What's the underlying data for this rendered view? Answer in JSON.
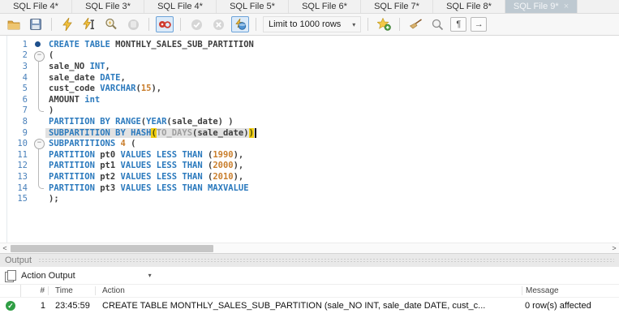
{
  "glyphs": {
    "close": "×",
    "dropdown": "▾",
    "scroll_left": "<",
    "scroll_right": ">",
    "pilcrow": "¶",
    "wrap_arrow": "→",
    "check": "✓"
  },
  "tabs": [
    {
      "label": "SQL File 4*",
      "active": false
    },
    {
      "label": "SQL File 3*",
      "active": false
    },
    {
      "label": "SQL File 4*",
      "active": false
    },
    {
      "label": "SQL File 5*",
      "active": false
    },
    {
      "label": "SQL File 6*",
      "active": false
    },
    {
      "label": "SQL File 7*",
      "active": false
    },
    {
      "label": "SQL File 8*",
      "active": false
    },
    {
      "label": "SQL File 9*",
      "active": true
    }
  ],
  "toolbar": {
    "limit_label": "Limit to 1000 rows",
    "icons": [
      "open-file",
      "save",
      "execute",
      "execute-current-statement",
      "explain",
      "stop",
      "toggle-stop-on-error",
      "commit",
      "rollback",
      "toggle-autocommit",
      "save-snippet",
      "beautify",
      "find",
      "show-invisible-characters",
      "toggle-wrap"
    ]
  },
  "editor": {
    "lines": [
      {
        "n": "1",
        "marker": "dot",
        "segments": [
          {
            "t": "CREATE TABLE",
            "c": "kw"
          },
          {
            "t": " MONTHLY_SALES_SUB_PARTITION",
            "c": "id"
          }
        ]
      },
      {
        "n": "2",
        "marker": "open",
        "segments": [
          {
            "t": "(",
            "c": "id"
          }
        ]
      },
      {
        "n": "3",
        "marker": "vline",
        "segments": [
          {
            "t": "sale_NO ",
            "c": "id"
          },
          {
            "t": "INT",
            "c": "kw"
          },
          {
            "t": ",",
            "c": "id"
          }
        ]
      },
      {
        "n": "4",
        "marker": "vline",
        "segments": [
          {
            "t": "sale_date ",
            "c": "id"
          },
          {
            "t": "DATE",
            "c": "kw"
          },
          {
            "t": ",",
            "c": "id"
          }
        ]
      },
      {
        "n": "5",
        "marker": "vline",
        "segments": [
          {
            "t": "cust_code ",
            "c": "id"
          },
          {
            "t": "VARCHAR",
            "c": "kw"
          },
          {
            "t": "(",
            "c": "id"
          },
          {
            "t": "15",
            "c": "num"
          },
          {
            "t": "),",
            "c": "id"
          }
        ]
      },
      {
        "n": "6",
        "marker": "vline",
        "segments": [
          {
            "t": "AMOUNT ",
            "c": "id"
          },
          {
            "t": "int",
            "c": "kw"
          }
        ]
      },
      {
        "n": "7",
        "marker": "end",
        "segments": [
          {
            "t": ")",
            "c": "id"
          }
        ]
      },
      {
        "n": "8",
        "marker": "",
        "segments": [
          {
            "t": "PARTITION BY RANGE",
            "c": "kw"
          },
          {
            "t": "(",
            "c": "id"
          },
          {
            "t": "YEAR",
            "c": "kw"
          },
          {
            "t": "(sale_date) )",
            "c": "id"
          }
        ]
      },
      {
        "n": "9",
        "marker": "",
        "highlight": true,
        "cursor": true,
        "segments": [
          {
            "t": "SUBPARTITION BY HASH",
            "c": "kw"
          },
          {
            "t": "(",
            "c": "hlp"
          },
          {
            "t": "TO_DAYS",
            "c": "fn"
          },
          {
            "t": "(sale_date)",
            "c": "id"
          },
          {
            "t": ")",
            "c": "hlp"
          }
        ]
      },
      {
        "n": "10",
        "marker": "open",
        "segments": [
          {
            "t": "SUBPARTITIONS ",
            "c": "kw"
          },
          {
            "t": "4",
            "c": "num"
          },
          {
            "t": " (",
            "c": "id"
          }
        ]
      },
      {
        "n": "11",
        "marker": "vline",
        "segments": [
          {
            "t": "PARTITION ",
            "c": "kw"
          },
          {
            "t": "pt0 ",
            "c": "id"
          },
          {
            "t": "VALUES LESS THAN ",
            "c": "kw"
          },
          {
            "t": "(",
            "c": "id"
          },
          {
            "t": "1990",
            "c": "num"
          },
          {
            "t": "),",
            "c": "id"
          }
        ]
      },
      {
        "n": "12",
        "marker": "vline",
        "segments": [
          {
            "t": "PARTITION ",
            "c": "kw"
          },
          {
            "t": "pt1 ",
            "c": "id"
          },
          {
            "t": "VALUES LESS THAN ",
            "c": "kw"
          },
          {
            "t": "(",
            "c": "id"
          },
          {
            "t": "2000",
            "c": "num"
          },
          {
            "t": "),",
            "c": "id"
          }
        ]
      },
      {
        "n": "13",
        "marker": "vline",
        "segments": [
          {
            "t": "PARTITION ",
            "c": "kw"
          },
          {
            "t": "pt2 ",
            "c": "id"
          },
          {
            "t": "VALUES LESS THAN ",
            "c": "kw"
          },
          {
            "t": "(",
            "c": "id"
          },
          {
            "t": "2010",
            "c": "num"
          },
          {
            "t": "),",
            "c": "id"
          }
        ]
      },
      {
        "n": "14",
        "marker": "end",
        "segments": [
          {
            "t": "PARTITION ",
            "c": "kw"
          },
          {
            "t": "pt3 ",
            "c": "id"
          },
          {
            "t": "VALUES LESS THAN MAXVALUE",
            "c": "kw"
          }
        ]
      },
      {
        "n": "15",
        "marker": "",
        "segments": [
          {
            "t": ");",
            "c": "id"
          }
        ]
      }
    ]
  },
  "output": {
    "panel_title": "Output",
    "view_selector": "Action Output",
    "columns": [
      "#",
      "Time",
      "Action",
      "Message"
    ],
    "rows": [
      {
        "status": "success",
        "num": "1",
        "time": "23:45:59",
        "action": "CREATE TABLE MONTHLY_SALES_SUB_PARTITION (sale_NO INT,  sale_date DATE,  cust_c...",
        "message": "0 row(s) affected"
      }
    ]
  }
}
